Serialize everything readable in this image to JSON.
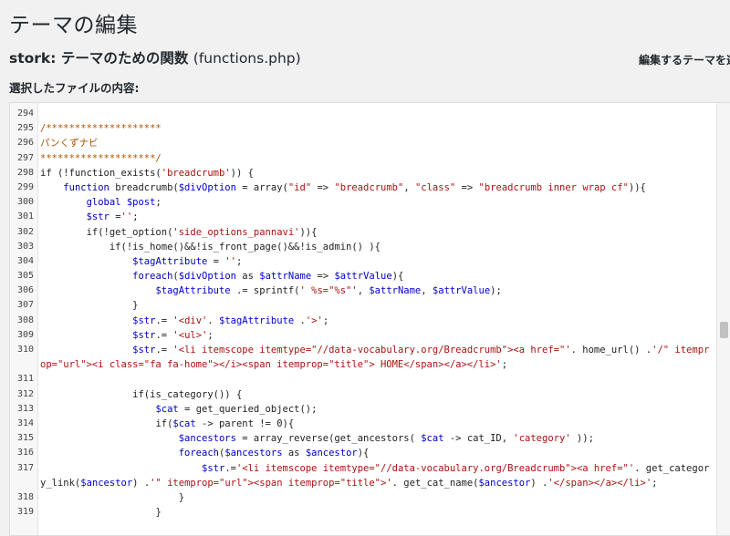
{
  "page": {
    "title": "テーマの編集",
    "theme_name": "stork:",
    "file_title": "テーマのための関数",
    "file_name": "(functions.php)",
    "select_label": "編集するテーマを選",
    "content_label": "選択したファイルの内容:"
  },
  "editor": {
    "lines": [
      {
        "n": "294",
        "parts": []
      },
      {
        "n": "295",
        "parts": [
          {
            "t": "/********************",
            "c": "c"
          }
        ]
      },
      {
        "n": "296",
        "parts": [
          {
            "t": "パンくずナビ",
            "c": "c"
          }
        ]
      },
      {
        "n": "297",
        "parts": [
          {
            "t": "********************/",
            "c": "c"
          }
        ]
      },
      {
        "n": "298",
        "parts": [
          {
            "t": "if (!function_exists("
          },
          {
            "t": "'breadcrumb'",
            "c": "s"
          },
          {
            "t": ")) {"
          }
        ]
      },
      {
        "n": "299",
        "parts": [
          {
            "t": "    "
          },
          {
            "t": "function",
            "c": "k"
          },
          {
            "t": " breadcrumb("
          },
          {
            "t": "$divOption",
            "c": "v"
          },
          {
            "t": " = array("
          },
          {
            "t": "\"id\"",
            "c": "s"
          },
          {
            "t": " => "
          },
          {
            "t": "\"breadcrumb\"",
            "c": "s"
          },
          {
            "t": ", "
          },
          {
            "t": "\"class\"",
            "c": "s"
          },
          {
            "t": " => "
          },
          {
            "t": "\"breadcrumb inner wrap cf\"",
            "c": "s"
          },
          {
            "t": ")){"
          }
        ]
      },
      {
        "n": "300",
        "parts": [
          {
            "t": "        "
          },
          {
            "t": "global",
            "c": "k"
          },
          {
            "t": " "
          },
          {
            "t": "$post",
            "c": "v"
          },
          {
            "t": ";"
          }
        ]
      },
      {
        "n": "301",
        "parts": [
          {
            "t": "        "
          },
          {
            "t": "$str",
            "c": "v"
          },
          {
            "t": " ="
          },
          {
            "t": "''",
            "c": "s"
          },
          {
            "t": ";"
          }
        ]
      },
      {
        "n": "302",
        "parts": [
          {
            "t": "        if(!get_option("
          },
          {
            "t": "'side_options_pannavi'",
            "c": "s"
          },
          {
            "t": ")){"
          }
        ]
      },
      {
        "n": "303",
        "parts": [
          {
            "t": "            if(!is_home()&&!is_front_page()&&!is_admin() ){"
          }
        ]
      },
      {
        "n": "304",
        "parts": [
          {
            "t": "                "
          },
          {
            "t": "$tagAttribute",
            "c": "v"
          },
          {
            "t": " = "
          },
          {
            "t": "''",
            "c": "s"
          },
          {
            "t": ";"
          }
        ]
      },
      {
        "n": "305",
        "parts": [
          {
            "t": "                "
          },
          {
            "t": "foreach",
            "c": "k"
          },
          {
            "t": "("
          },
          {
            "t": "$divOption",
            "c": "v"
          },
          {
            "t": " as "
          },
          {
            "t": "$attrName",
            "c": "v"
          },
          {
            "t": " => "
          },
          {
            "t": "$attrValue",
            "c": "v"
          },
          {
            "t": "){"
          }
        ]
      },
      {
        "n": "306",
        "parts": [
          {
            "t": "                    "
          },
          {
            "t": "$tagAttribute",
            "c": "v"
          },
          {
            "t": " .= sprintf("
          },
          {
            "t": "' %s=\"%s\"'",
            "c": "s"
          },
          {
            "t": ", "
          },
          {
            "t": "$attrName",
            "c": "v"
          },
          {
            "t": ", "
          },
          {
            "t": "$attrValue",
            "c": "v"
          },
          {
            "t": ");"
          }
        ]
      },
      {
        "n": "307",
        "parts": [
          {
            "t": "                }"
          }
        ]
      },
      {
        "n": "308",
        "parts": [
          {
            "t": "                "
          },
          {
            "t": "$str",
            "c": "v"
          },
          {
            "t": ".= "
          },
          {
            "t": "'<div'",
            "c": "s"
          },
          {
            "t": ". "
          },
          {
            "t": "$tagAttribute",
            "c": "v"
          },
          {
            "t": " ."
          },
          {
            "t": "'>'",
            "c": "s"
          },
          {
            "t": ";"
          }
        ]
      },
      {
        "n": "309",
        "parts": [
          {
            "t": "                "
          },
          {
            "t": "$str",
            "c": "v"
          },
          {
            "t": ".= "
          },
          {
            "t": "'<ul>'",
            "c": "s"
          },
          {
            "t": ";"
          }
        ]
      },
      {
        "n": "310",
        "wrap": true,
        "parts": [
          {
            "t": "                "
          },
          {
            "t": "$str",
            "c": "v"
          },
          {
            "t": ".= "
          },
          {
            "t": "'<li itemscope itemtype=\"//data-vocabulary.org/Breadcrumb\"><a href=\"'",
            "c": "s"
          },
          {
            "t": ". home_url() ."
          },
          {
            "t": "'/\" itemprop=\"url\"><i class=\"fa fa-home\"></i><span itemprop=\"title\"> HOME</span></a></li>'",
            "c": "s"
          },
          {
            "t": ";"
          }
        ]
      },
      {
        "n": "311",
        "parts": []
      },
      {
        "n": "312",
        "parts": [
          {
            "t": "                if(is_category()) {"
          }
        ]
      },
      {
        "n": "313",
        "parts": [
          {
            "t": "                    "
          },
          {
            "t": "$cat",
            "c": "v"
          },
          {
            "t": " = get_queried_object();"
          }
        ]
      },
      {
        "n": "314",
        "parts": [
          {
            "t": "                    if("
          },
          {
            "t": "$cat",
            "c": "v"
          },
          {
            "t": " -> parent != 0){"
          }
        ]
      },
      {
        "n": "315",
        "parts": [
          {
            "t": "                        "
          },
          {
            "t": "$ancestors",
            "c": "v"
          },
          {
            "t": " = array_reverse(get_ancestors( "
          },
          {
            "t": "$cat",
            "c": "v"
          },
          {
            "t": " -> cat_ID, "
          },
          {
            "t": "'category'",
            "c": "s"
          },
          {
            "t": " ));"
          }
        ]
      },
      {
        "n": "316",
        "parts": [
          {
            "t": "                        "
          },
          {
            "t": "foreach",
            "c": "k"
          },
          {
            "t": "("
          },
          {
            "t": "$ancestors",
            "c": "v"
          },
          {
            "t": " as "
          },
          {
            "t": "$ancestor",
            "c": "v"
          },
          {
            "t": "){"
          }
        ]
      },
      {
        "n": "317",
        "wrap": true,
        "parts": [
          {
            "t": "                            "
          },
          {
            "t": "$str",
            "c": "v"
          },
          {
            "t": ".="
          },
          {
            "t": "'<li itemscope itemtype=\"//data-vocabulary.org/Breadcrumb\"><a href=\"'",
            "c": "s"
          },
          {
            "t": ". get_category_link("
          },
          {
            "t": "$ancestor",
            "c": "v"
          },
          {
            "t": ") ."
          },
          {
            "t": "'\" itemprop=\"url\"><span itemprop=\"title\">'",
            "c": "s"
          },
          {
            "t": ". get_cat_name("
          },
          {
            "t": "$ancestor",
            "c": "v"
          },
          {
            "t": ") ."
          },
          {
            "t": "'</span></a></li>'",
            "c": "s"
          },
          {
            "t": ";"
          }
        ]
      },
      {
        "n": "318",
        "parts": [
          {
            "t": "                        }"
          }
        ]
      },
      {
        "n": "319",
        "parts": [
          {
            "t": "                    }"
          }
        ]
      }
    ]
  },
  "colors": {
    "keyword": "#0000aa",
    "variable": "#0000cc",
    "string": "#aa1111",
    "comment": "#aa5500"
  }
}
